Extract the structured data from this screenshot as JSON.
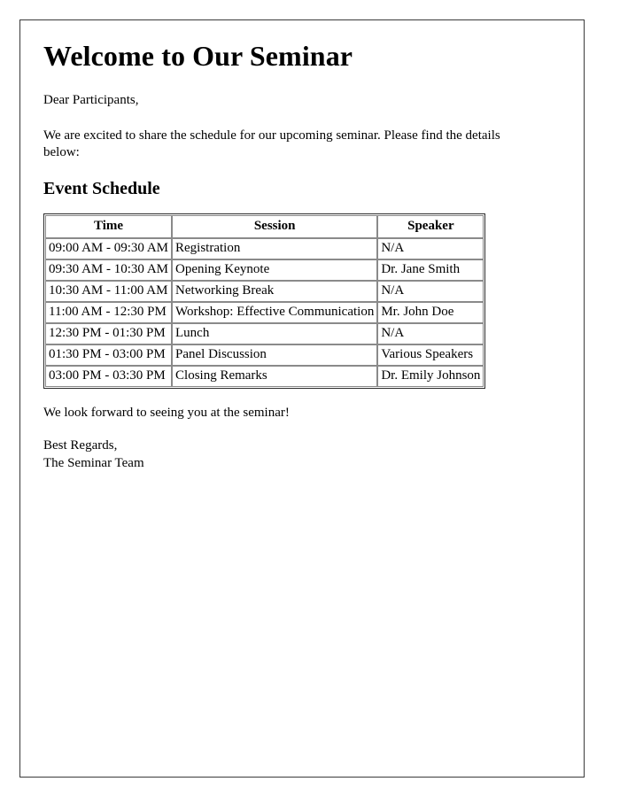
{
  "document": {
    "title": "Welcome to Our Seminar",
    "salutation": "Dear Participants,",
    "intro": "We are excited to share the schedule for our upcoming seminar. Please find the details below:",
    "section_title": "Event Schedule",
    "closing_line": "We look forward to seeing you at the seminar!",
    "signoff_line_1": "Best Regards,",
    "signoff_line_2": "The Seminar Team"
  },
  "schedule_table": {
    "headers": [
      "Time",
      "Session",
      "Speaker"
    ],
    "rows": [
      {
        "time": "09:00 AM - 09:30 AM",
        "session": "Registration",
        "speaker": "N/A"
      },
      {
        "time": "09:30 AM - 10:30 AM",
        "session": "Opening Keynote",
        "speaker": "Dr. Jane Smith"
      },
      {
        "time": "10:30 AM - 11:00 AM",
        "session": "Networking Break",
        "speaker": "N/A"
      },
      {
        "time": "11:00 AM - 12:30 PM",
        "session": "Workshop: Effective Communication",
        "speaker": "Mr. John Doe"
      },
      {
        "time": "12:30 PM - 01:30 PM",
        "session": "Lunch",
        "speaker": "N/A"
      },
      {
        "time": "01:30 PM - 03:00 PM",
        "session": "Panel Discussion",
        "speaker": "Various Speakers"
      },
      {
        "time": "03:00 PM - 03:30 PM",
        "session": "Closing Remarks",
        "speaker": "Dr. Emily Johnson"
      }
    ]
  },
  "colors": {
    "page_border": "#3a3a3a",
    "table_outer_border": "#2b2b2b",
    "table_cell_border": "#8a8a8a",
    "text": "#000000",
    "background": "#ffffff"
  }
}
